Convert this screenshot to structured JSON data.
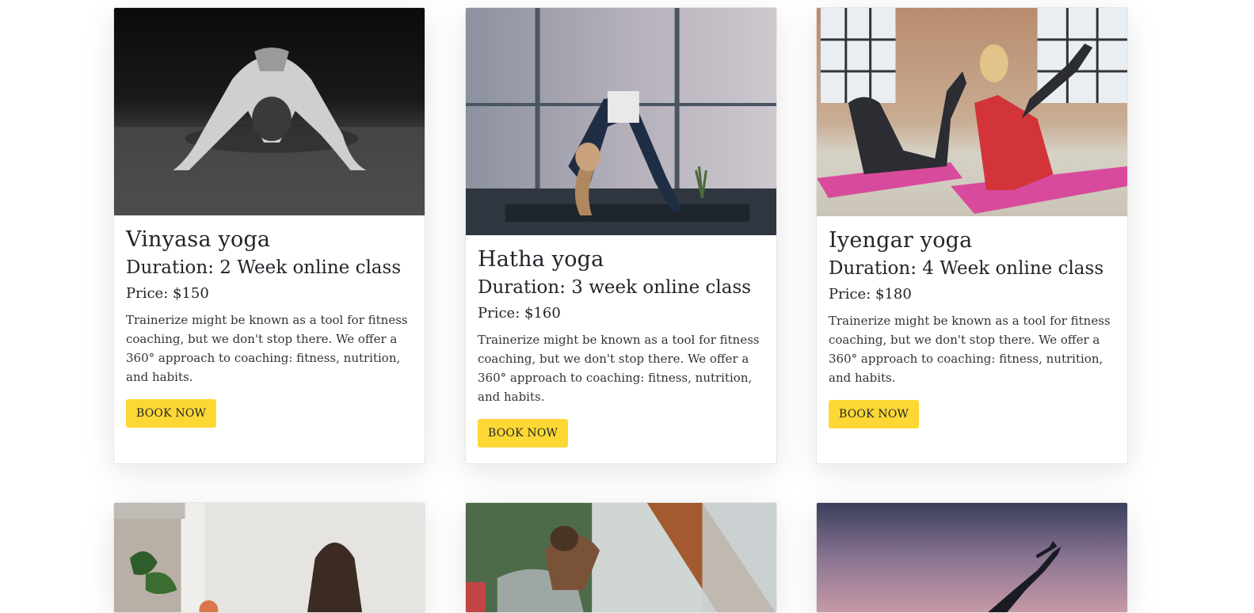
{
  "cards": [
    {
      "title": "Vinyasa yoga",
      "duration": "Duration: 2 Week online class",
      "price": "Price: $150",
      "description": "Trainerize might be known as a tool for fitness coaching, but we don't stop there. We offer a 360° approach to coaching: fitness, nutrition, and habits.",
      "button": "BOOK NOW",
      "image": "black-and-white-yoga-photo"
    },
    {
      "title": "Hatha yoga",
      "duration": "Duration: 3 week online class",
      "price": "Price: $160",
      "description": "Trainerize might be known as a tool for fitness coaching, but we don't stop there. We offer a 360° approach to coaching: fitness, nutrition, and habits.",
      "button": "BOOK NOW",
      "image": "triangle-pose-photo"
    },
    {
      "title": "Iyengar yoga",
      "duration": "Duration: 4 Week online class",
      "price": "Price: $180",
      "description": "Trainerize might be known as a tool for fitness coaching, but we don't stop there. We offer a 360° approach to coaching: fitness, nutrition, and habits.",
      "button": "BOOK NOW",
      "image": "group-fitness-photo"
    },
    {
      "image": "seated-yoga-photo"
    },
    {
      "image": "stretching-yoga-photo"
    },
    {
      "image": "sunset-yoga-photo"
    }
  ],
  "colors": {
    "button": "#fdd835",
    "text": "#212529"
  }
}
